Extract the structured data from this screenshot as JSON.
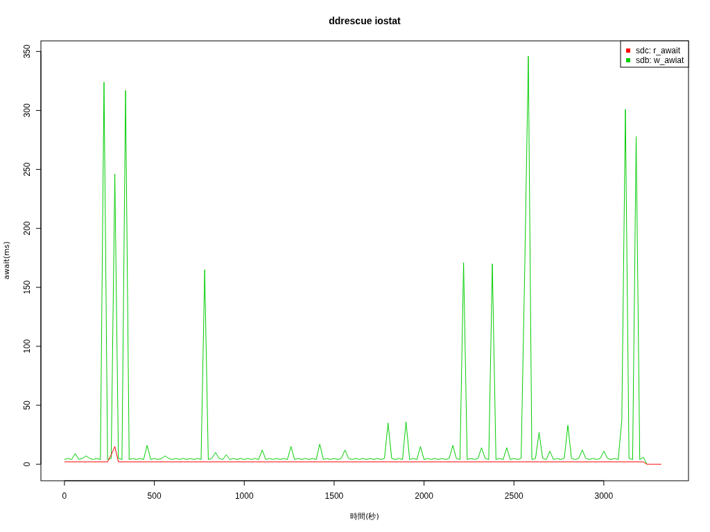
{
  "chart": {
    "chart_data": {
      "type": "line",
      "title": "ddrescue iostat",
      "xlabel": "時間(秒)",
      "ylabel": "await(ms)",
      "legend": true,
      "xlim": [
        -131,
        3471
      ],
      "ylim": [
        -14,
        359
      ],
      "xticks": [
        0,
        500,
        1000,
        1500,
        2000,
        2500,
        3000
      ],
      "yticks": [
        0,
        50,
        100,
        150,
        200,
        250,
        300,
        350
      ],
      "x": [
        0,
        20,
        40,
        60,
        80,
        100,
        120,
        140,
        160,
        180,
        200,
        220,
        240,
        260,
        280,
        300,
        320,
        340,
        360,
        380,
        400,
        420,
        440,
        460,
        480,
        500,
        520,
        540,
        560,
        580,
        600,
        620,
        640,
        660,
        680,
        700,
        720,
        740,
        760,
        780,
        800,
        820,
        840,
        860,
        880,
        900,
        920,
        940,
        960,
        980,
        1000,
        1020,
        1040,
        1060,
        1080,
        1100,
        1120,
        1140,
        1160,
        1180,
        1200,
        1220,
        1240,
        1260,
        1280,
        1300,
        1320,
        1340,
        1360,
        1380,
        1400,
        1420,
        1440,
        1460,
        1480,
        1500,
        1520,
        1540,
        1560,
        1580,
        1600,
        1620,
        1640,
        1660,
        1680,
        1700,
        1720,
        1740,
        1760,
        1780,
        1800,
        1820,
        1840,
        1860,
        1880,
        1900,
        1920,
        1940,
        1960,
        1980,
        2000,
        2020,
        2040,
        2060,
        2080,
        2100,
        2120,
        2140,
        2160,
        2180,
        2200,
        2220,
        2240,
        2260,
        2280,
        2300,
        2320,
        2340,
        2360,
        2380,
        2400,
        2420,
        2440,
        2460,
        2480,
        2500,
        2520,
        2540,
        2560,
        2580,
        2600,
        2620,
        2640,
        2660,
        2680,
        2700,
        2720,
        2740,
        2760,
        2780,
        2800,
        2820,
        2840,
        2860,
        2880,
        2900,
        2920,
        2940,
        2960,
        2980,
        3000,
        3020,
        3040,
        3060,
        3080,
        3100,
        3120,
        3140,
        3160,
        3180,
        3200,
        3220,
        3240,
        3260,
        3280,
        3300,
        3320
      ],
      "series": [
        {
          "name": "sdc: r_await",
          "color": "#ff0000",
          "values": [
            2,
            2,
            2,
            2,
            2,
            2,
            2,
            2,
            2,
            2,
            2,
            2,
            2,
            8,
            15,
            2,
            2,
            2,
            2,
            2,
            2,
            2,
            2,
            2,
            2,
            2,
            2,
            2,
            2,
            2,
            2,
            2,
            2,
            2,
            2,
            2,
            2,
            2,
            2,
            2,
            2,
            2,
            2,
            2,
            2,
            2,
            2,
            2,
            2,
            2,
            2,
            2,
            2,
            2,
            2,
            2,
            2,
            2,
            2,
            2,
            2,
            2,
            2,
            2,
            2,
            2,
            2,
            2,
            2,
            2,
            2,
            2,
            2,
            2,
            2,
            2,
            2,
            2,
            2,
            2,
            2,
            2,
            2,
            2,
            2,
            2,
            2,
            2,
            2,
            2,
            2,
            2,
            2,
            2,
            2,
            2,
            2,
            2,
            2,
            2,
            2,
            2,
            2,
            2,
            2,
            2,
            2,
            2,
            2,
            2,
            2,
            2,
            2,
            2,
            2,
            2,
            2,
            2,
            2,
            2,
            2,
            2,
            2,
            2,
            2,
            2,
            2,
            2,
            2,
            2,
            2,
            2,
            2,
            2,
            2,
            2,
            2,
            2,
            2,
            2,
            2,
            2,
            2,
            2,
            2,
            2,
            2,
            2,
            2,
            2,
            2,
            2,
            2,
            2,
            2,
            2,
            2,
            2,
            2,
            2,
            2,
            2,
            0,
            0,
            0,
            0,
            0
          ]
        },
        {
          "name": "sdb: w_awiat",
          "color": "#00cd00",
          "values": [
            4,
            5,
            4,
            9,
            4,
            5,
            7,
            5,
            4,
            5,
            4,
            324,
            4,
            5,
            246,
            5,
            4,
            317,
            4,
            5,
            4,
            5,
            4,
            16,
            4,
            5,
            4,
            5,
            7,
            5,
            4,
            5,
            4,
            5,
            4,
            5,
            4,
            5,
            4,
            165,
            4,
            5,
            10,
            5,
            4,
            8,
            4,
            5,
            4,
            5,
            4,
            5,
            4,
            5,
            4,
            12,
            4,
            5,
            4,
            5,
            4,
            5,
            4,
            15,
            4,
            5,
            4,
            5,
            4,
            5,
            4,
            17,
            4,
            5,
            4,
            5,
            4,
            5,
            12,
            5,
            4,
            5,
            4,
            5,
            4,
            5,
            4,
            5,
            4,
            5,
            35,
            5,
            4,
            5,
            4,
            36,
            4,
            5,
            4,
            15,
            4,
            5,
            4,
            5,
            4,
            5,
            4,
            5,
            16,
            5,
            4,
            171,
            4,
            5,
            4,
            5,
            14,
            5,
            4,
            170,
            4,
            5,
            4,
            14,
            4,
            5,
            4,
            5,
            166,
            346,
            4,
            5,
            27,
            5,
            4,
            11,
            4,
            5,
            4,
            5,
            33,
            5,
            4,
            5,
            12,
            5,
            4,
            5,
            4,
            5,
            11,
            5,
            4,
            5,
            4,
            37,
            301,
            5,
            4,
            278,
            4,
            6,
            0,
            null,
            null,
            null,
            null
          ]
        }
      ]
    }
  }
}
